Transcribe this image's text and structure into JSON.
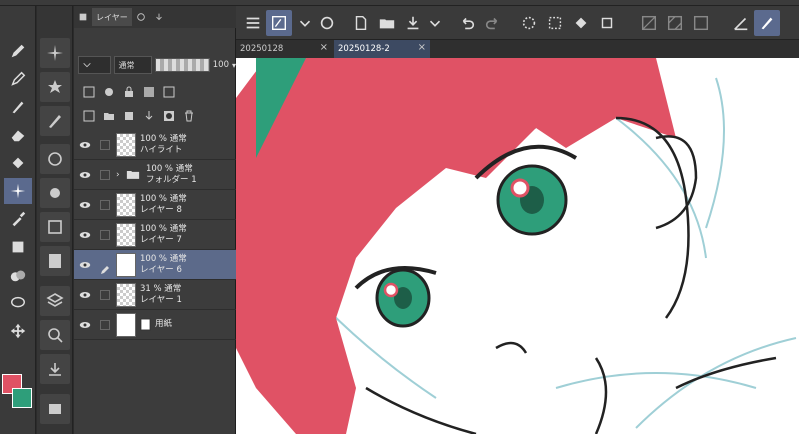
{
  "panel": {
    "layer_tab": "レイヤー",
    "blend_mode": "通常",
    "opacity_value": "100",
    "opacity_arrow": "▾"
  },
  "tabs": [
    {
      "label": "20250128"
    },
    {
      "label": "20250128-2"
    }
  ],
  "layers": [
    {
      "opacity": "100 % 通常",
      "name": "ハイライト"
    },
    {
      "opacity": "100 % 通常",
      "name": "フォルダー 1"
    },
    {
      "opacity": "100 % 通常",
      "name": "レイヤー 8"
    },
    {
      "opacity": "100 % 通常",
      "name": "レイヤー 7"
    },
    {
      "opacity": "100 % 通常",
      "name": "レイヤー 6"
    },
    {
      "opacity": "31 % 通常",
      "name": "レイヤー 1"
    },
    {
      "opacity": "",
      "name": "用紙"
    }
  ],
  "colors": {
    "main_color": "#e05265",
    "sub_color": "#2e9e7a",
    "selection": "#5c6a8a",
    "hair": "#e05265",
    "eye": "#2e9e7a",
    "sketch": "#9fcfd6"
  }
}
